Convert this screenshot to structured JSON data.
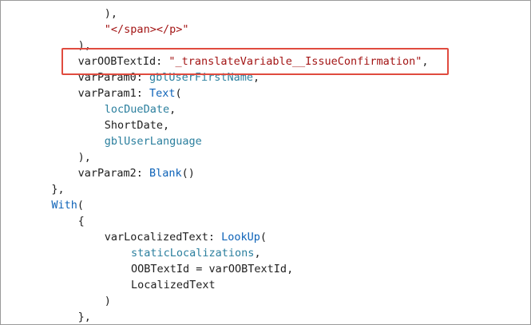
{
  "colors": {
    "plain": "#1e1e1e",
    "string": "#a31515",
    "function": "#0e63b8",
    "variable": "#2b7f9e",
    "highlight_border": "#e04b3f"
  },
  "code_lines": [
    {
      "indent": 4,
      "tokens": [
        {
          "t": "),",
          "c": "plain"
        }
      ]
    },
    {
      "indent": 4,
      "tokens": [
        {
          "t": "\"</span></p>\"",
          "c": "str"
        }
      ]
    },
    {
      "indent": 3,
      "tokens": [
        {
          "t": "),",
          "c": "plain"
        }
      ]
    },
    {
      "indent": 3,
      "tokens": [
        {
          "t": "varOOBTextId: ",
          "c": "plain"
        },
        {
          "t": "\"_translateVariable__IssueConfirmation\"",
          "c": "str"
        },
        {
          "t": ",",
          "c": "plain"
        }
      ]
    },
    {
      "indent": 3,
      "tokens": [
        {
          "t": "varParam0: ",
          "c": "plain"
        },
        {
          "t": "gblUserFirstName",
          "c": "var"
        },
        {
          "t": ",",
          "c": "plain"
        }
      ]
    },
    {
      "indent": 3,
      "tokens": [
        {
          "t": "varParam1: ",
          "c": "plain"
        },
        {
          "t": "Text",
          "c": "fn"
        },
        {
          "t": "(",
          "c": "plain"
        }
      ]
    },
    {
      "indent": 4,
      "tokens": [
        {
          "t": "locDueDate",
          "c": "var"
        },
        {
          "t": ",",
          "c": "plain"
        }
      ]
    },
    {
      "indent": 4,
      "tokens": [
        {
          "t": "ShortDate,",
          "c": "plain"
        }
      ]
    },
    {
      "indent": 4,
      "tokens": [
        {
          "t": "gblUserLanguage",
          "c": "var"
        }
      ]
    },
    {
      "indent": 3,
      "tokens": [
        {
          "t": "),",
          "c": "plain"
        }
      ]
    },
    {
      "indent": 3,
      "tokens": [
        {
          "t": "varParam2: ",
          "c": "plain"
        },
        {
          "t": "Blank",
          "c": "fn"
        },
        {
          "t": "()",
          "c": "plain"
        }
      ]
    },
    {
      "indent": 2,
      "tokens": [
        {
          "t": "},",
          "c": "plain"
        }
      ]
    },
    {
      "indent": 2,
      "tokens": [
        {
          "t": "With",
          "c": "fn"
        },
        {
          "t": "(",
          "c": "plain"
        }
      ]
    },
    {
      "indent": 3,
      "tokens": [
        {
          "t": "{",
          "c": "plain"
        }
      ]
    },
    {
      "indent": 4,
      "tokens": [
        {
          "t": "varLocalizedText: ",
          "c": "plain"
        },
        {
          "t": "LookUp",
          "c": "fn"
        },
        {
          "t": "(",
          "c": "plain"
        }
      ]
    },
    {
      "indent": 5,
      "tokens": [
        {
          "t": "staticLocalizations",
          "c": "var"
        },
        {
          "t": ",",
          "c": "plain"
        }
      ]
    },
    {
      "indent": 5,
      "tokens": [
        {
          "t": "OOBTextId = varOOBTextId,",
          "c": "plain"
        }
      ]
    },
    {
      "indent": 5,
      "tokens": [
        {
          "t": "LocalizedText",
          "c": "plain"
        }
      ]
    },
    {
      "indent": 4,
      "tokens": [
        {
          "t": ")",
          "c": "plain"
        }
      ]
    },
    {
      "indent": 3,
      "tokens": [
        {
          "t": "},",
          "c": "plain"
        }
      ]
    }
  ]
}
